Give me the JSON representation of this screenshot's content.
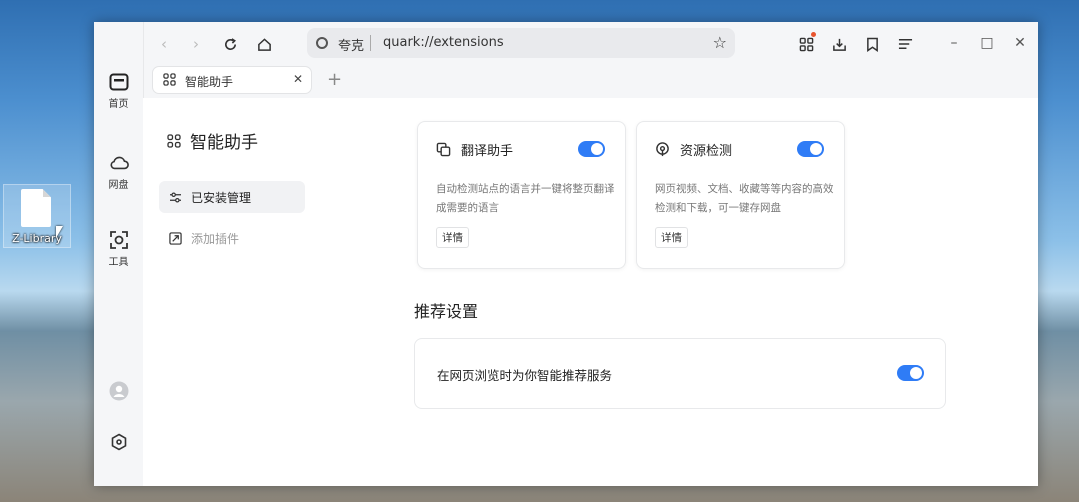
{
  "desktop": {
    "file_label": "Z-Library"
  },
  "sidebar": {
    "items": [
      {
        "label": "首页",
        "icon": "home-icon"
      },
      {
        "label": "网盘",
        "icon": "cloud-icon"
      },
      {
        "label": "工具",
        "icon": "scan-icon"
      }
    ],
    "avatar_icon": "avatar-icon",
    "settings_icon": "hexagon-settings-icon"
  },
  "toolbar": {
    "address_brand": "夸克",
    "address_url": "quark://extensions",
    "accent_dot_color": "#e8542e"
  },
  "tabs": [
    {
      "label": "智能助手"
    }
  ],
  "extensions_page": {
    "title": "智能助手",
    "menu": [
      {
        "label": "已安装管理",
        "active": true
      },
      {
        "label": "添加插件",
        "active": false
      }
    ],
    "cards": [
      {
        "title": "翻译助手",
        "description": "自动检测站点的语言并一键将整页翻译成需要的语言",
        "details_label": "详情",
        "enabled": true
      },
      {
        "title": "资源检测",
        "description": "网页视频、文档、收藏等等内容的高效检测和下载，可一键存网盘",
        "details_label": "详情",
        "enabled": true
      }
    ],
    "recommend": {
      "section_title": "推荐设置",
      "item_label": "在网页浏览时为你智能推荐服务",
      "enabled": true
    },
    "accent_color": "#2f7cf6"
  }
}
